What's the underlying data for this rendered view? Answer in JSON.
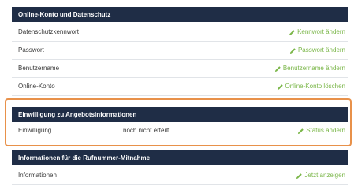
{
  "sections": [
    {
      "title": "Online-Konto und Datenschutz",
      "rows": [
        {
          "label": "Datenschutzkennwort",
          "value": "",
          "action": "Kennwort ändern"
        },
        {
          "label": "Passwort",
          "value": "",
          "action": "Passwort ändern"
        },
        {
          "label": "Benutzername",
          "value": "",
          "action": "Benutzername ändern"
        },
        {
          "label": "Online-Konto",
          "value": "",
          "action": "Online-Konto löschen"
        }
      ]
    },
    {
      "title": "Einwilligung zu Angebotsinformationen",
      "rows": [
        {
          "label": "Einwilligung",
          "value": "noch nicht erteilt",
          "action": "Status ändern"
        }
      ]
    },
    {
      "title": "Informationen für die Rufnummer-Mitnahme",
      "rows": [
        {
          "label": "Informationen",
          "value": "",
          "action": "Jetzt anzeigen"
        }
      ]
    }
  ],
  "colors": {
    "header_bg": "#1f2d46",
    "action_green": "#7ab648",
    "highlight_orange": "#e8914a"
  },
  "icons": {
    "action": "pencil-icon"
  }
}
